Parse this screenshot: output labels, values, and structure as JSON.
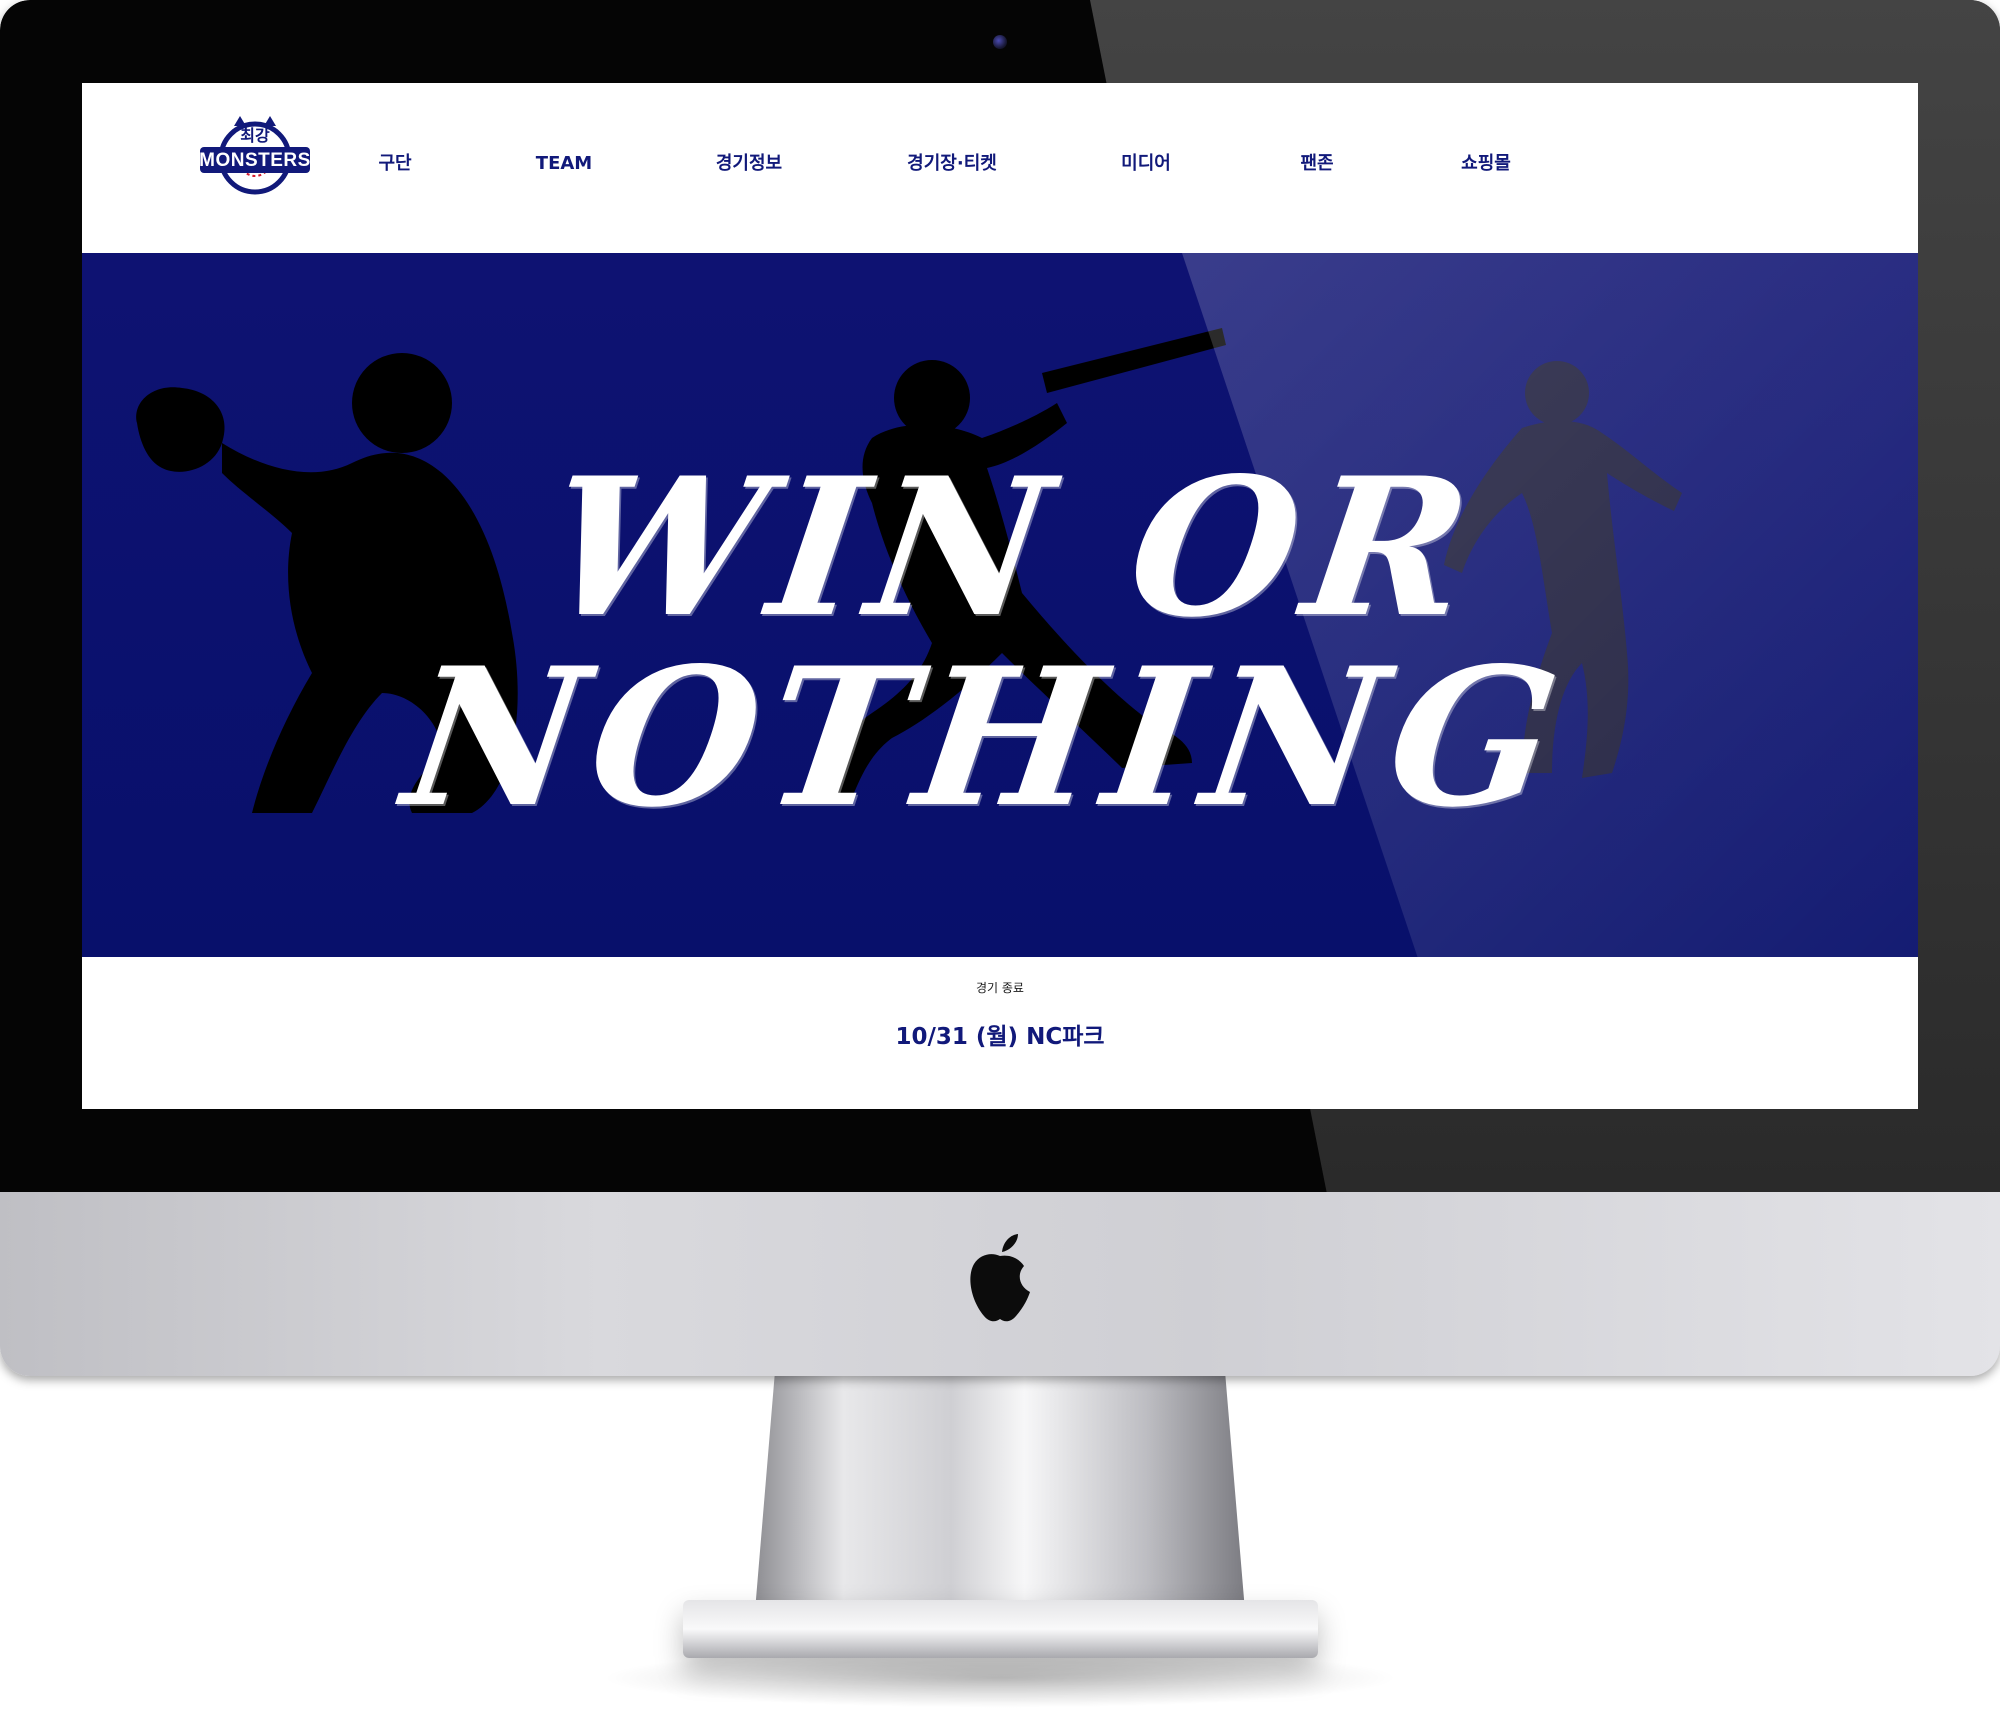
{
  "header": {
    "logo_text": "MONSTERS",
    "logo_top_text": "최강",
    "nav": [
      {
        "label": "구단"
      },
      {
        "label": "TEAM"
      },
      {
        "label": "경기정보"
      },
      {
        "label": "경기장·티켓"
      },
      {
        "label": "미디어"
      },
      {
        "label": "팬존"
      },
      {
        "label": "쇼핑몰"
      }
    ]
  },
  "hero": {
    "title": "WIN OR NOTHING"
  },
  "match": {
    "status": "경기 종료",
    "date_venue": "10/31 (월) NC파크"
  },
  "colors": {
    "brand_navy": "#11197a",
    "hero_blue": "#0e1272",
    "bezel_black": "#050505"
  },
  "icons": [
    "apple-logo-icon",
    "camera-icon"
  ]
}
